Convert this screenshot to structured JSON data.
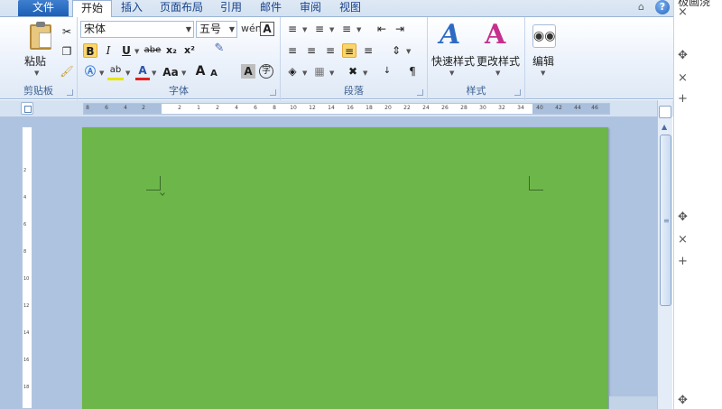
{
  "tabs": {
    "file": "文件",
    "items": [
      "开始",
      "插入",
      "页面布局",
      "引用",
      "邮件",
      "审阅",
      "视图"
    ],
    "active_index": 0,
    "help": "?"
  },
  "clipboard": {
    "paste": "粘贴",
    "label": "剪贴板"
  },
  "font": {
    "name": "宋体",
    "size": "五号",
    "label": "字体",
    "bold": "B",
    "italic": "I",
    "underline": "U",
    "strike": "abe",
    "subscript": "x₂",
    "superscript": "x²",
    "grow": "A",
    "shrink": "A",
    "case": "Aa",
    "phonetic": "wén",
    "border_char": "A",
    "char_shade": "A",
    "enclose": "字"
  },
  "paragraph": {
    "label": "段落"
  },
  "styles": {
    "quick": "快速样式",
    "change": "更改样式",
    "label": "样式"
  },
  "editing": {
    "label": "编辑"
  },
  "ruler": {
    "ticks": [
      "8",
      "6",
      "4",
      "2",
      "2",
      "1",
      "2",
      "4",
      "6",
      "8",
      "10",
      "12",
      "14",
      "16",
      "18",
      "20",
      "22",
      "24",
      "26",
      "28",
      "30",
      "32",
      "34",
      "36",
      "38",
      "40",
      "42",
      "44",
      "46"
    ]
  },
  "vruler": {
    "ticks": [
      "2",
      "4",
      "6",
      "8",
      "10",
      "12",
      "14",
      "16",
      "18"
    ]
  },
  "taskpane": {
    "title": "极画浇"
  },
  "colors": {
    "page": "#6db74a",
    "accent": "#2a66bf",
    "highlight": "#fbd66d"
  }
}
